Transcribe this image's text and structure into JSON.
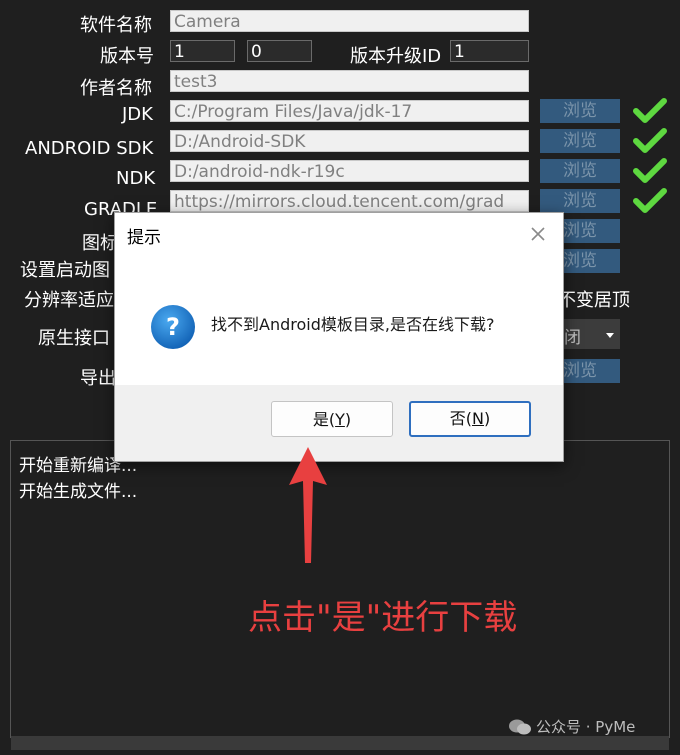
{
  "form": {
    "name_label": "软件名称",
    "name_value": "Camera",
    "version_label": "版本号",
    "version_major": "1",
    "version_minor": "0",
    "upgrade_id_label": "版本升级ID",
    "upgrade_id_value": "1",
    "author_label": "作者名称",
    "author_value": "test3",
    "jdk_label": "JDK",
    "jdk_path": "C:/Program Files/Java/jdk-17",
    "sdk_label": "ANDROID SDK",
    "sdk_path": "D:/Android-SDK",
    "ndk_label": "NDK",
    "ndk_path": "D:/android-ndk-r19c",
    "gradle_label": "GRADLE",
    "gradle_path": "https://mirrors.cloud.tencent.com/grad",
    "icon_label": "图标",
    "splash_label": "设置启动图",
    "resolution_label": "分辨率适应",
    "keep_top_text": "不变居顶",
    "native_label": "原生接口",
    "native_value": "闭",
    "export_label": "导出",
    "browse_label": "浏览"
  },
  "log": {
    "lines": [
      "开始重新编译...",
      "开始生成文件..."
    ]
  },
  "dialog": {
    "title": "提示",
    "message": "找不到Android模板目录,是否在线下载?",
    "yes_label": "是(",
    "yes_key": "Y",
    "yes_end": ")",
    "no_label": "否(",
    "no_key": "N",
    "no_end": ")"
  },
  "annotation": {
    "text": "点击\"是\"进行下载",
    "color": "#e84040"
  },
  "watermark": {
    "text": "公众号 · PyMe"
  }
}
